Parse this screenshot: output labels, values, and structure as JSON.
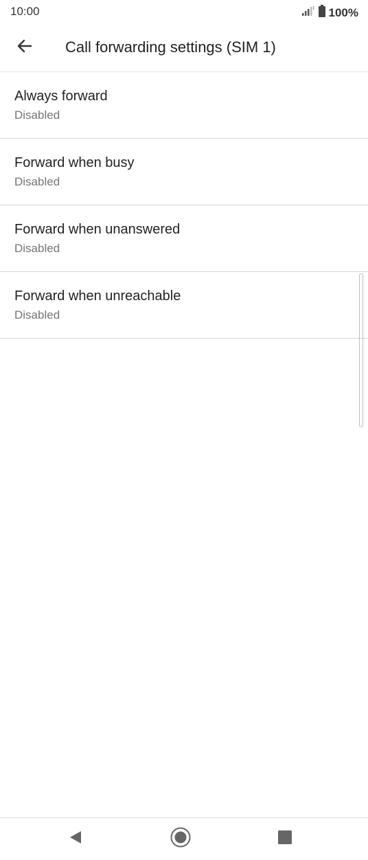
{
  "status_bar": {
    "time": "10:00",
    "battery_percent": "100%",
    "icons": [
      "signal-icon",
      "battery-icon"
    ]
  },
  "app_bar": {
    "title": "Call forwarding settings (SIM 1)",
    "back_icon": "back-arrow-icon"
  },
  "options": [
    {
      "title": "Always forward",
      "summary": "Disabled"
    },
    {
      "title": "Forward when busy",
      "summary": "Disabled"
    },
    {
      "title": "Forward when unanswered",
      "summary": "Disabled"
    },
    {
      "title": "Forward when unreachable",
      "summary": "Disabled"
    }
  ],
  "nav_bar": {
    "icons": [
      "nav-back-icon",
      "nav-home-icon",
      "nav-recents-icon"
    ]
  },
  "colors": {
    "primary_text": "#222222",
    "secondary_text": "#757575",
    "divider": "#d8d8d8"
  }
}
